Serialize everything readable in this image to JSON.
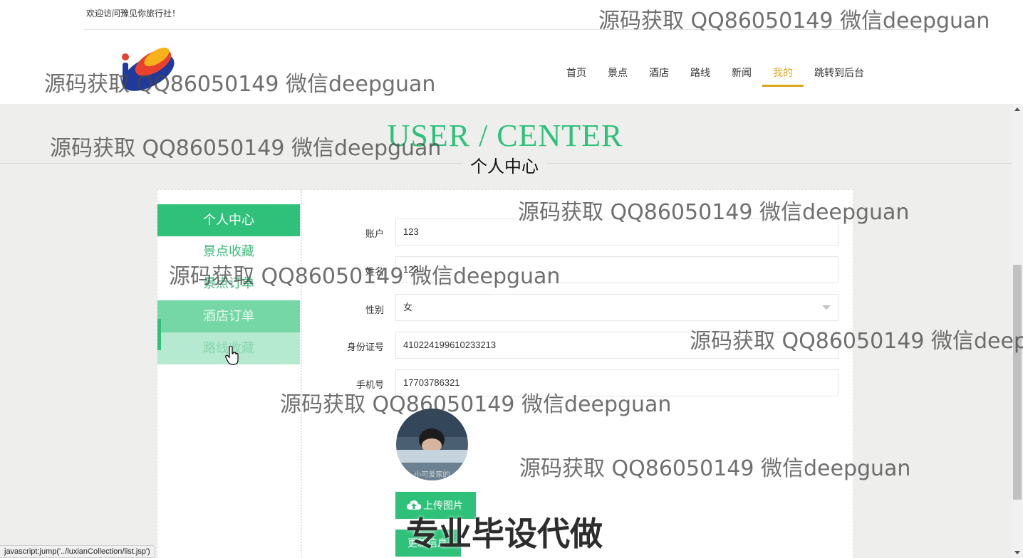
{
  "header": {
    "welcome": "欢迎访问豫见你旅行社！",
    "nav": [
      "首页",
      "景点",
      "酒店",
      "路线",
      "新闻",
      "我的",
      "跳转到后台"
    ],
    "active_nav": "我的"
  },
  "section": {
    "title_en": "USER / CENTER",
    "title_cn": "个人中心"
  },
  "sidebar": {
    "items": [
      "个人中心",
      "景点收藏",
      "景点订单",
      "酒店订单",
      "路线收藏"
    ]
  },
  "form": {
    "account_label": "账户",
    "account_value": "123",
    "name_label": "姓名",
    "name_value": "123",
    "gender_label": "性别",
    "gender_value": "女",
    "idcard_label": "身份证号",
    "idcard_value": "410224199610233213",
    "phone_label": "手机号",
    "phone_value": "17703786321",
    "avatar_caption": "小可爱家的",
    "upload_label": "上传图片",
    "update_label": "更新信息"
  },
  "statusbar": {
    "text": "javascript:jump('../luxianCollection/list.jsp')"
  },
  "watermarks": {
    "text": "源码获取 QQ86050149 微信deepguan",
    "text_cut": "源码获取 QQ86050149 微信deepg",
    "big": "专业毕设代做"
  },
  "colors": {
    "accent_green": "#2fc17a",
    "nav_active": "#d9a81a"
  }
}
